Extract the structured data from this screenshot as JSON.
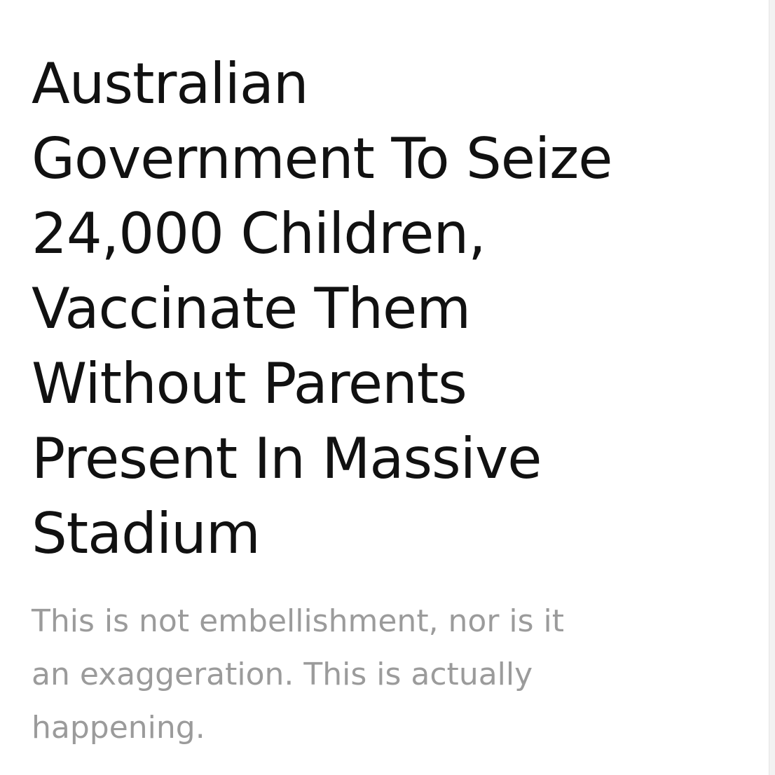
{
  "article": {
    "headline_lines": [
      "Australian",
      "Government To Seize",
      "24,000 Children,",
      "Vaccinate Them",
      "Without Parents",
      "Present In Massive",
      "Stadium"
    ],
    "subtitle_lines": [
      "This is not embellishment, nor is it",
      "an exaggeration. This is actually",
      "happening."
    ]
  },
  "colors": {
    "background": "#ffffff",
    "headline_text": "#111111",
    "subtitle_text": "#9b9b9b"
  }
}
